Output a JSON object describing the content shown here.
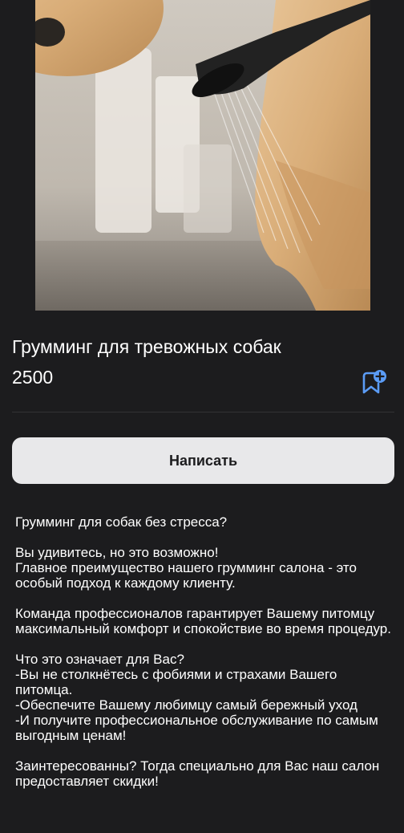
{
  "listing": {
    "title": "Грумминг для тревожных собак",
    "price": "2500",
    "photo_alt": "photo"
  },
  "icons": {
    "bookmark": "bookmark-add-icon"
  },
  "actions": {
    "write_label": "Написать"
  },
  "description": {
    "paragraphs": [
      "Грумминг для собак без стресса?",
      "Вы удивитесь, но это возможно!\nГлавное преимущество нашего грумминг салона - это особый подход к каждому клиенту.",
      "Команда профессионалов гарантирует Вашему питомцу максимальный комфорт и спокойствие во время процедур.",
      "Что это означает для Вас?\n-Вы не столкнётесь с фобиями и страхами Вашего питомца.\n-Обеспечите Вашему любимцу самый бережный уход\n-И получите профессиональное обслуживание по самым выгодным ценам!",
      "Заинтересованны? Тогда специально для Вас наш салон предоставляет скидки!"
    ]
  },
  "colors": {
    "background": "#1c1c1e",
    "button_bg": "#e8e8ea",
    "accent": "#5b9cf6"
  }
}
